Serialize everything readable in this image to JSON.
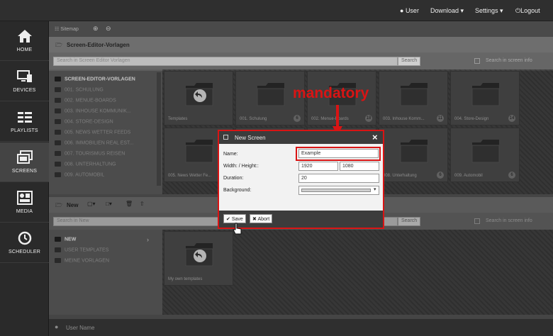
{
  "topbar": {
    "user": "User",
    "download": "Download",
    "settings": "Settings",
    "logout": "Logout"
  },
  "sidebar": [
    {
      "label": "HOME",
      "icon": "home-icon"
    },
    {
      "label": "DEVICES",
      "icon": "devices-icon"
    },
    {
      "label": "PLAYLISTS",
      "icon": "playlists-icon"
    },
    {
      "label": "SCREENS",
      "icon": "screens-icon"
    },
    {
      "label": "MEDIA",
      "icon": "media-icon"
    },
    {
      "label": "SCHEDULER",
      "icon": "scheduler-icon"
    }
  ],
  "toolbar": {
    "sitemap": "Sitemap"
  },
  "panel1": {
    "title": "Screen-Editor-Vorlagen",
    "search_placeholder": "Search in Screen Editor Vorlagen",
    "search_button": "Search",
    "search_info": "Search in screen info",
    "tree_root": "SCREEN-EDITOR-VORLAGEN",
    "tree_items": [
      "001. SCHULUNG",
      "002. MENUE-BOARDS",
      "003. INHOUSE KOMMUNIK...",
      "004. STORE-DESIGN",
      "005. NEWS WETTER FEEDS",
      "006. IMMOBILIEN REAL EST...",
      "007. TOURISMUS REISEN",
      "008. UNTERHALTUNG",
      "009. AUTOMOBIL"
    ],
    "tiles": [
      {
        "label": "Templates",
        "badge": ""
      },
      {
        "label": "001. Schulung",
        "badge": "6"
      },
      {
        "label": "002. Menue-Boards",
        "badge": "18"
      },
      {
        "label": "003. Inhouse Komm...",
        "badge": "11"
      },
      {
        "label": "004. Store-Design",
        "badge": "14"
      },
      {
        "label": "005. News Wetter Fe...",
        "badge": ""
      },
      {
        "label": "",
        "badge": ""
      },
      {
        "label": "",
        "badge": ""
      },
      {
        "label": "008. Unterhaltung",
        "badge": "6"
      },
      {
        "label": "009. Automobil",
        "badge": "6"
      }
    ]
  },
  "panel2": {
    "title": "New",
    "search_placeholder": "Search in New",
    "search_button": "Search",
    "search_info": "Search in screen info",
    "tree_root": "NEW",
    "tree_items": [
      "USER TEMPLATES",
      "MEINE VORLAGEN"
    ],
    "tiles": [
      {
        "label": "My own templates",
        "badge": ""
      }
    ]
  },
  "footer": {
    "user_name": "User Name"
  },
  "dialog": {
    "title": "New Screen",
    "name_label": "Name:",
    "name_value": "Example",
    "size_label": "Width: / Height::",
    "width_value": "1920",
    "height_value": "1080",
    "duration_label": "Duration:",
    "duration_value": "20",
    "background_label": "Background:",
    "save": "Save",
    "abort": "Abort"
  },
  "annotation": {
    "text": "mandatory",
    "color": "#d91414"
  }
}
